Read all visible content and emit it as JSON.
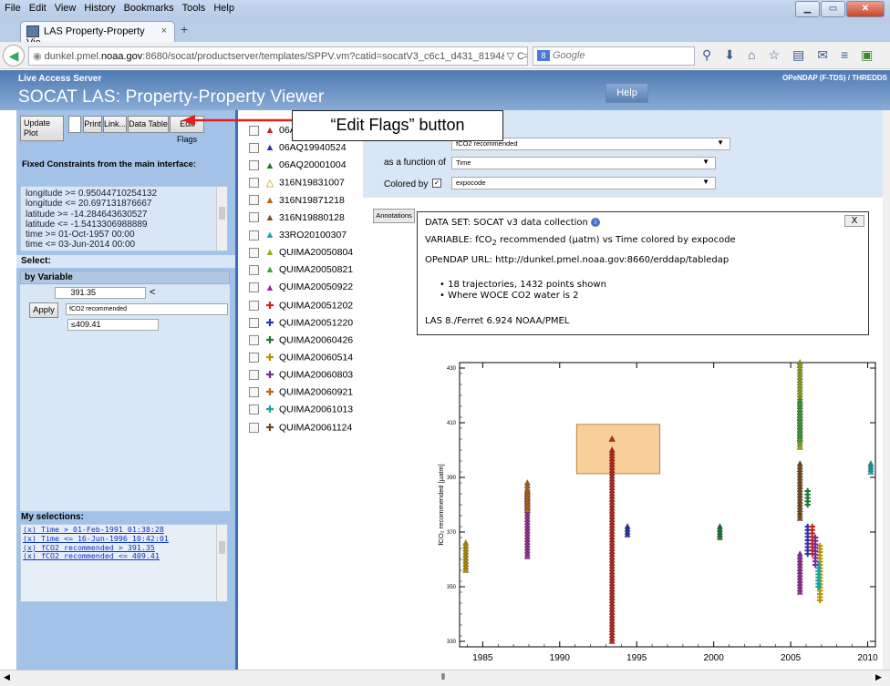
{
  "menubar": [
    "File",
    "Edit",
    "View",
    "History",
    "Bookmarks",
    "Tools",
    "Help"
  ],
  "tab": {
    "title": "LAS Property-Property Vie...",
    "close": "×",
    "new": "+"
  },
  "nav": {
    "url_pre": "dunkel.pmel.",
    "url_host": "noaa.gov",
    "url_post": ":8680/socat/productserver/templates/SPPV.vm?catid=socatV3_c6c1_d431_8194&xml=<%3Fxml",
    "search_placeholder": "Google",
    "search_engine": "8"
  },
  "las": {
    "small_title": "Live Access Server",
    "title": "SOCAT LAS: Property-Property Viewer",
    "right_label": "OPeNDAP (F-TDS) / THREDDS",
    "help_label": "Help"
  },
  "left": {
    "update_plot": "Update Plot",
    "print": "Print",
    "link": "Link...",
    "data_table": "Data Table",
    "edit_flags": "Edit Flags",
    "fixed_title": "Fixed Constraints from the main interface:",
    "constraints": [
      "longitude >= 0.95044710254132",
      "longitude <= 20.697131876667",
      "latitude >= -14.284643630527",
      "latitude <= -1.5413306988889",
      "time >= 01-Oct-1957 00:00",
      "time <= 03-Jun-2014 00:00"
    ],
    "select_label": "Select:",
    "by_variable": "by Variable",
    "min_value": "391.35",
    "lt": "<",
    "apply": "Apply",
    "variable": "fCO2 recommended",
    "max_value": "≤409.41",
    "my_selections": "My selections:",
    "selections": [
      "(x) Time > 01-Feb-1991 01:38:28",
      "(x) Time <= 16-Jun-1996 10:42:01",
      "(x) fCO2 recommended > 391.35",
      "(x) fCO2 recommended <= 409.41"
    ]
  },
  "trajectories": [
    {
      "name": "06A",
      "symbol": "▲",
      "color": "#c0281f"
    },
    {
      "name": "06AQ19940524",
      "symbol": "▲",
      "color": "#2d36a8"
    },
    {
      "name": "06AQ20001004",
      "symbol": "▲",
      "color": "#1b7a33"
    },
    {
      "name": "316N19831007",
      "symbol": "△",
      "color": "#b79400"
    },
    {
      "name": "316N19871218",
      "symbol": "▲",
      "color": "#b8651a"
    },
    {
      "name": "316N19880128",
      "symbol": "▲",
      "color": "#7b4f20"
    },
    {
      "name": "33RO20100307",
      "symbol": "▲",
      "color": "#19a3a3"
    },
    {
      "name": "QUIMA20050804",
      "symbol": "▲",
      "color": "#8fae1d"
    },
    {
      "name": "QUIMA20050821",
      "symbol": "▲",
      "color": "#3aa832"
    },
    {
      "name": "QUIMA20050922",
      "symbol": "▲",
      "color": "#9b2c9e"
    },
    {
      "name": "QUIMA20051202",
      "symbol": "✚",
      "color": "#c0281f"
    },
    {
      "name": "QUIMA20051220",
      "symbol": "✚",
      "color": "#2d36a8"
    },
    {
      "name": "QUIMA20060426",
      "symbol": "✚",
      "color": "#1b7a33"
    },
    {
      "name": "QUIMA20060514",
      "symbol": "✚",
      "color": "#b79400"
    },
    {
      "name": "QUIMA20060803",
      "symbol": "✚",
      "color": "#7b2a9b"
    },
    {
      "name": "QUIMA20060921",
      "symbol": "✚",
      "color": "#b8651a"
    },
    {
      "name": "QUIMA20061013",
      "symbol": "✚",
      "color": "#19a3a3"
    },
    {
      "name": "QUIMA20061124",
      "symbol": "✚",
      "color": "#6b4a1b"
    }
  ],
  "controls": {
    "y_value": "fCO2 recommended",
    "as_function_label": "as a function of",
    "x_value": "Time",
    "colored_by_label": "Colored by",
    "color_value": "expocode"
  },
  "annotations": {
    "button": "Annotations",
    "close": "X",
    "dataset": "DATA SET: SOCAT v3 data collection",
    "variable_pre": "VARIABLE: fCO",
    "variable_sub": "2",
    "variable_post": " recommended (μatm) vs Time colored by expocode",
    "opendap": "OPeNDAP URL: http://dunkel.pmel.noaa.gov:8660/erddap/tabledap",
    "bullets": [
      "18 trajectories, 1432 points shown",
      "Where WOCE CO2 water is 2"
    ],
    "footer": "LAS 8./Ferret 6.924 NOAA/PMEL"
  },
  "callout": "“Edit Flags” button",
  "chart_data": {
    "type": "scatter",
    "title": "",
    "xlabel": "",
    "ylabel": "fCO₂ recommended [µatm]",
    "xlim": [
      1983.5,
      2010.5
    ],
    "ylim": [
      328,
      432
    ],
    "xticks": [
      1985,
      1990,
      1995,
      2000,
      2005,
      2010
    ],
    "yticks": [
      330,
      350,
      370,
      390,
      410,
      430
    ],
    "selection_box": {
      "x": [
        1991.1,
        1996.5
      ],
      "y": [
        391.35,
        409.41
      ]
    },
    "series": [
      {
        "color": "#c0281f",
        "marker": "triangle",
        "x": 1993.4,
        "y": [
          330,
          400
        ]
      },
      {
        "color": "#c0281f",
        "marker": "triangle",
        "x": 1993.4,
        "y": [
          404,
          404
        ]
      },
      {
        "color": "#2d36a8",
        "marker": "triangle",
        "x": 1994.4,
        "y": [
          369,
          372
        ]
      },
      {
        "color": "#b79400",
        "marker": "triangle",
        "x": 1983.9,
        "y": [
          356,
          366
        ]
      },
      {
        "color": "#9b2c9e",
        "marker": "triangle",
        "x": 1987.9,
        "y": [
          361,
          385
        ]
      },
      {
        "color": "#b8651a",
        "marker": "triangle",
        "x": 1987.9,
        "y": [
          378,
          388
        ]
      },
      {
        "color": "#1b7a33",
        "marker": "triangle",
        "x": 2000.4,
        "y": [
          368,
          372
        ]
      },
      {
        "color": "#8fae1d",
        "marker": "triangle",
        "x": 2005.6,
        "y": [
          401,
          432
        ]
      },
      {
        "color": "#3aa832",
        "marker": "triangle",
        "x": 2005.6,
        "y": [
          404,
          418
        ]
      },
      {
        "color": "#7b4f20",
        "marker": "triangle",
        "x": 2005.6,
        "y": [
          375,
          395
        ]
      },
      {
        "color": "#9b2c9e",
        "marker": "triangle",
        "x": 2005.6,
        "y": [
          348,
          362
        ]
      },
      {
        "color": "#2d36a8",
        "marker": "cross",
        "x": 2006.1,
        "y": [
          362,
          372
        ]
      },
      {
        "color": "#1b7a33",
        "marker": "cross",
        "x": 2006.1,
        "y": [
          380,
          385
        ]
      },
      {
        "color": "#c0281f",
        "marker": "cross",
        "x": 2006.4,
        "y": [
          362,
          372
        ]
      },
      {
        "color": "#b79400",
        "marker": "cross",
        "x": 2006.9,
        "y": [
          345,
          365
        ]
      },
      {
        "color": "#19a3a3",
        "marker": "cross",
        "x": 2006.8,
        "y": [
          350,
          358
        ]
      },
      {
        "color": "#7b2a9b",
        "marker": "cross",
        "x": 2006.6,
        "y": [
          358,
          368
        ]
      },
      {
        "color": "#19a3a3",
        "marker": "triangle",
        "x": 2010.2,
        "y": [
          392,
          395
        ]
      }
    ]
  }
}
